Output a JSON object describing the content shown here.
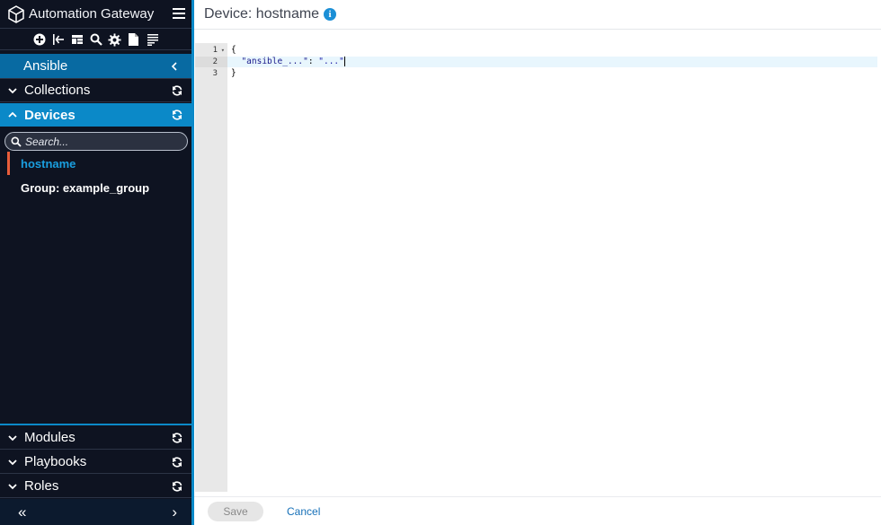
{
  "app": {
    "title": "Automation Gateway",
    "logo_icon": "gateway-logo-icon",
    "menu_icon": "hamburger-menu-icon"
  },
  "toolbar": {
    "icons": [
      "add-circle-icon",
      "import-icon",
      "grid-icon",
      "search-icon",
      "gear-icon",
      "file-icon",
      "list-icon"
    ]
  },
  "sidebar": {
    "ansible": {
      "label": "Ansible"
    },
    "collections": {
      "label": "Collections"
    },
    "devices": {
      "label": "Devices",
      "search_placeholder": "Search...",
      "items": [
        {
          "label": "hostname",
          "selected": true
        },
        {
          "label": "Group: example_group",
          "selected": false
        }
      ]
    },
    "modules": {
      "label": "Modules"
    },
    "playbooks": {
      "label": "Playbooks"
    },
    "roles": {
      "label": "Roles"
    },
    "footer": {
      "collapse": "«",
      "expand": "›"
    }
  },
  "main": {
    "title": "Device: hostname",
    "info": "i",
    "editor": {
      "lines": [
        {
          "num": "1",
          "text": "{"
        },
        {
          "num": "2",
          "key": "\"ansible_...\"",
          "sep": ": ",
          "value": "\"...\""
        },
        {
          "num": "3",
          "text": "}"
        }
      ]
    },
    "actions": {
      "save": "Save",
      "cancel": "Cancel"
    }
  },
  "colors": {
    "sidebar_bg": "#0e1321",
    "accent": "#0b89c8",
    "ansible_header": "#086aa2",
    "selected_text": "#1a9fe0",
    "selected_marker": "#e85d3a",
    "link": "#1670b8"
  }
}
